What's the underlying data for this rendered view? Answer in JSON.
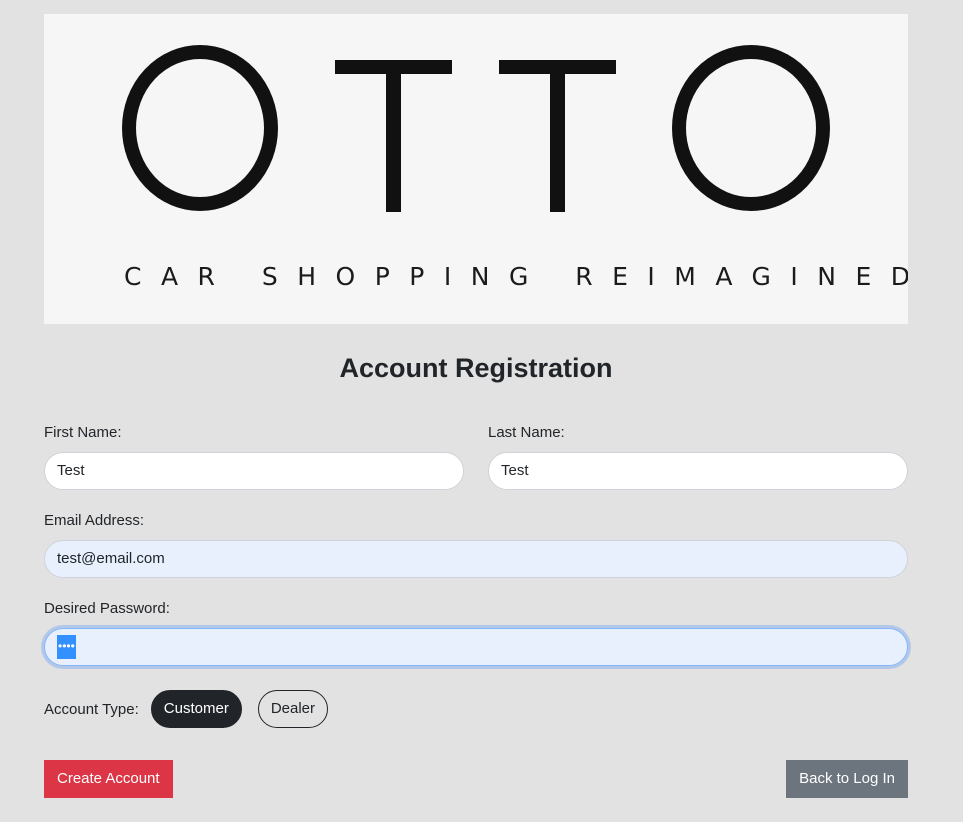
{
  "banner": {
    "logo_text": "OTTO",
    "tagline": "CAR SHOPPING REIMAGINED"
  },
  "page_title": "Account Registration",
  "form": {
    "first_name": {
      "label": "First Name:",
      "value": "Test"
    },
    "last_name": {
      "label": "Last Name:",
      "value": "Test"
    },
    "email": {
      "label": "Email Address:",
      "value": "test@email.com"
    },
    "password": {
      "label": "Desired Password:",
      "masked_value": "••••"
    },
    "account_type": {
      "label": "Account Type:",
      "options": [
        "Customer",
        "Dealer"
      ],
      "selected": "Customer"
    }
  },
  "actions": {
    "create_label": "Create Account",
    "back_label": "Back to Log In"
  },
  "colors": {
    "background": "#e2e2e2",
    "primary_dark": "#212529",
    "create_button": "#dc3545",
    "back_button": "#6c757d",
    "autofill": "#e8f0fe"
  }
}
